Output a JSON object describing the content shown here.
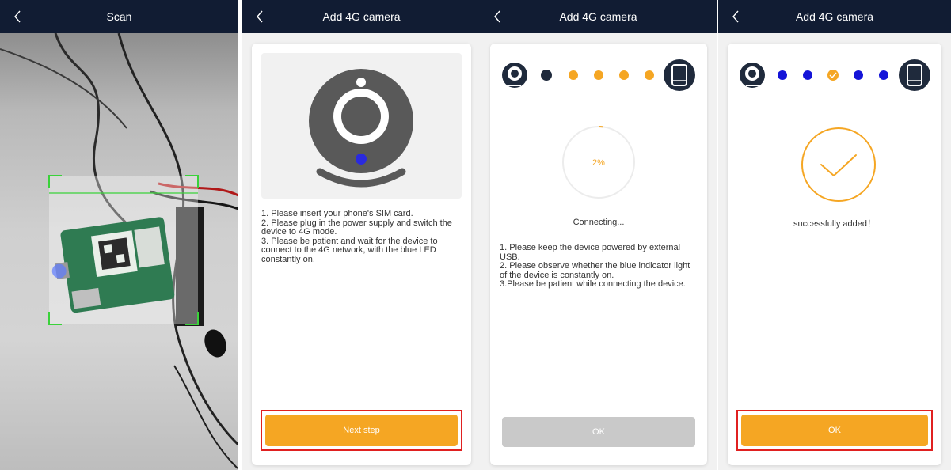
{
  "screens": [
    {
      "title": "Scan",
      "back_icon": "chevron-left-icon"
    },
    {
      "title": "Add 4G camera",
      "back_icon": "chevron-left-icon",
      "illustration_icon": "webcam-icon",
      "instructions": [
        "1. Please insert your phone's SIM card.",
        "2. Please plug in the power supply and switch the device to 4G mode.",
        "3. Please be patient and wait for the device to connect to the 4G network, with the blue LED constantly on."
      ],
      "button_label": "Next step"
    },
    {
      "title": "Add 4G camera",
      "back_icon": "chevron-left-icon",
      "progress_percent": 2,
      "progress_label": "2%",
      "status": "Connecting...",
      "instructions": [
        "1. Please keep the device powered by external USB.",
        "2. Please observe whether the blue indicator light of the device is constantly on.",
        "3.Please be patient while connecting the device."
      ],
      "button_label": "OK"
    },
    {
      "title": "Add 4G camera",
      "back_icon": "chevron-left-icon",
      "status": "successfully added！",
      "success_icon": "checkmark-icon",
      "button_label": "OK"
    }
  ],
  "colors": {
    "header_bg": "#111c33",
    "accent_orange": "#f5a623",
    "accent_blue": "#1414d8",
    "dark_dot": "#1f2a3c",
    "disabled_gray": "#c9c9c9",
    "highlight_red": "#e02020"
  }
}
